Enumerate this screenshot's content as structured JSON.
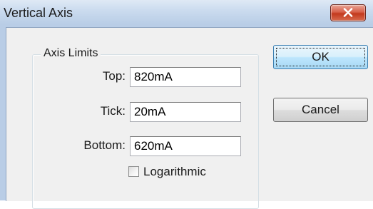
{
  "window": {
    "title": "Vertical Axis"
  },
  "axis_limits": {
    "legend": "Axis Limits",
    "top": {
      "label": "Top:",
      "value": "820mA"
    },
    "tick": {
      "label": "Tick:",
      "value": "20mA"
    },
    "bottom": {
      "label": "Bottom:",
      "value": "620mA"
    },
    "logarithmic": {
      "label": "Logarithmic",
      "checked": false
    }
  },
  "buttons": {
    "ok": "OK",
    "cancel": "Cancel"
  },
  "icons": {
    "close": "close-icon"
  },
  "colors": {
    "titlebar": "#b9cde6",
    "close_button": "#c2391d",
    "client_background": "#f0f0f0",
    "default_button_border": "#3c7fb1"
  }
}
